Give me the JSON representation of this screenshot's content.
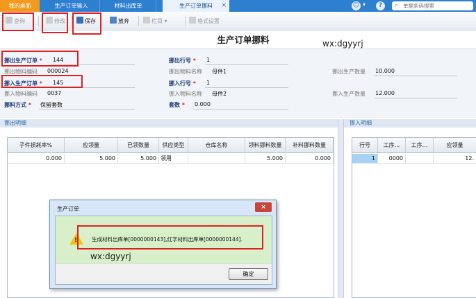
{
  "tabs": {
    "home": "我的桌面",
    "items": [
      "生产订单输入",
      "材料出库单",
      "生产订单挪料"
    ],
    "close": "×"
  },
  "header": {
    "search_placeholder": "单据条码搜索",
    "icons": [
      "smile-icon",
      "help-icon",
      "search-icon"
    ]
  },
  "toolbar": {
    "query": "查询",
    "edit": "修改",
    "save": "保存",
    "discard": "放弃",
    "columns": "栏目",
    "format": "格式设置"
  },
  "page_title": "生产订单挪料",
  "watermark": "wx:dgyyrj",
  "form": {
    "out_order_label": "挪出生产订单",
    "out_order_value": "144",
    "out_code_label": "挪出物料编码",
    "out_code_value": "000024",
    "in_order_label": "挪入生产订单",
    "in_order_value": "145",
    "in_code_label": "挪入物料编码",
    "in_code_value": "0037",
    "method_label": "挪料方式",
    "method_value": "保留套数",
    "out_line_label": "挪出行号",
    "out_line_value": "1",
    "out_name_label": "挪出物料名称",
    "out_name_value": "母件1",
    "in_line_label": "挪入行号",
    "in_line_value": "1",
    "in_name_label": "挪入物料名称",
    "in_name_value": "母件2",
    "sets_label": "套数",
    "sets_value": "0.000",
    "out_qty_label": "挪出生产数量",
    "out_qty_value": "10.000",
    "in_qty_label": "挪入生产数量",
    "in_qty_value": "12.000",
    "required_mark": "*"
  },
  "out_detail": {
    "title": "挪出明细",
    "columns": [
      "子件损耗率%",
      "应领量",
      "已领数量",
      "供应类型",
      "仓库名称",
      "领料挪料数量",
      "补料挪料数量"
    ],
    "rows": [
      [
        "0.000",
        "5.000",
        "5.000",
        "领用",
        "",
        "5.000",
        "0.000"
      ]
    ]
  },
  "in_detail": {
    "title": "挪入明细",
    "columns": [
      "行号",
      "工序...",
      "工序...",
      "应领量"
    ],
    "rows": [
      [
        "1",
        "0000",
        "",
        "12."
      ]
    ]
  },
  "dialog": {
    "title": "生产订单",
    "close": "×",
    "message": "生成材料出库单[0000000143],红字材料出库单[0000000144].",
    "ok": "确定"
  },
  "colors": {
    "tabbar": "#2d7fd0",
    "home_tab": "#f29a1d",
    "highlight_red": "#e02020",
    "dialog_message_bg": "#d8f0c9"
  }
}
